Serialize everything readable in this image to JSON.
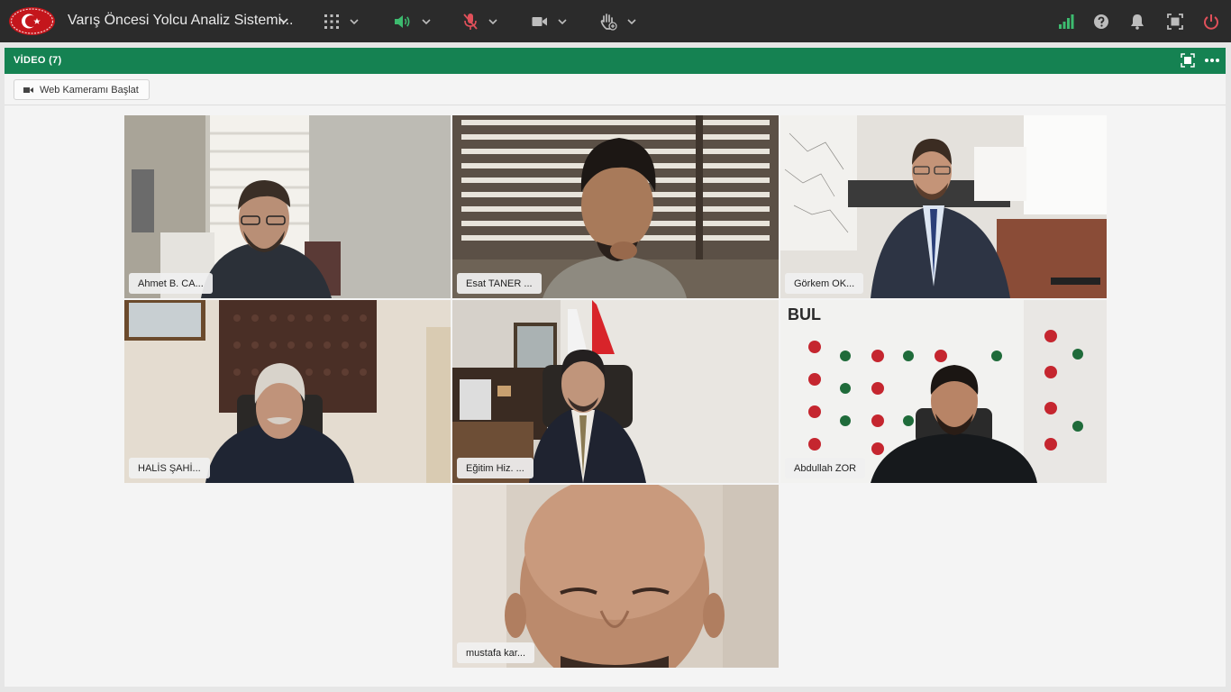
{
  "app": {
    "title": "Varış Öncesi Yolcu Analiz Sistemi...",
    "logo_icon": "crescent-star-emblem",
    "accent": "#158252",
    "brand_red": "#c4161c"
  },
  "topbar": {
    "controls": [
      {
        "name": "layout-grid",
        "icon": "grid-icon"
      },
      {
        "name": "speaker",
        "icon": "speaker-icon",
        "color": "#3dbb6f"
      },
      {
        "name": "microphone",
        "icon": "mic-muted-icon",
        "color": "#e0505a"
      },
      {
        "name": "camera",
        "icon": "camera-icon"
      },
      {
        "name": "raise-hand",
        "icon": "hand-icon"
      }
    ],
    "right": [
      {
        "name": "connection",
        "icon": "signal-bars-icon",
        "color": "#3dbb6f"
      },
      {
        "name": "help",
        "icon": "help-icon"
      },
      {
        "name": "notifications",
        "icon": "bell-icon"
      },
      {
        "name": "fullscreen",
        "icon": "fullscreen-icon"
      },
      {
        "name": "exit",
        "icon": "power-icon",
        "color": "#e0505a"
      }
    ]
  },
  "panel": {
    "title": "VİDEO (7)",
    "start_camera_label": "Web Kameramı Başlat"
  },
  "participants": [
    {
      "name": "Ahmet B. CA..."
    },
    {
      "name": "Esat TANER ..."
    },
    {
      "name": "Görkem OK..."
    },
    {
      "name": "HALİS ŞAHİ..."
    },
    {
      "name": "Eğitim Hiz. ..."
    },
    {
      "name": "Abdullah ZOR"
    },
    {
      "name": "mustafa kar..."
    }
  ]
}
